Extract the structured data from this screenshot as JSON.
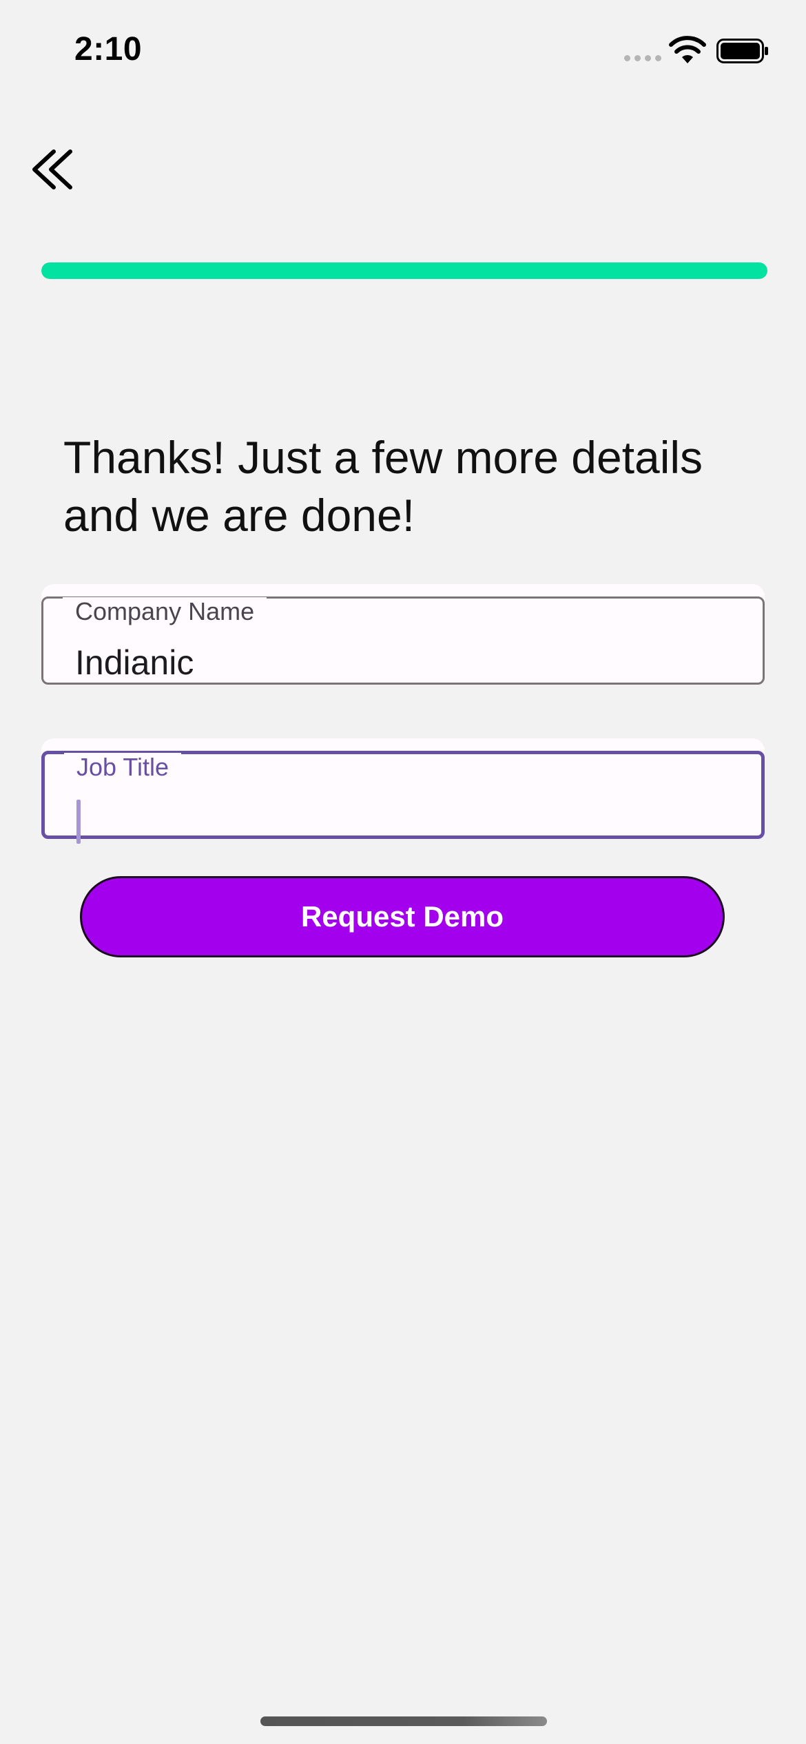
{
  "status_bar": {
    "time": "2:10"
  },
  "navigation": {
    "back_icon": "double-chevron-left-icon"
  },
  "progress": {
    "percent": 100,
    "color": "#03e2a1"
  },
  "heading": {
    "text": "Thanks! Just a few more details and we are done!"
  },
  "form": {
    "company_name": {
      "label": "Company Name",
      "value": "Indianic"
    },
    "job_title": {
      "label": "Job Title",
      "value": "",
      "focused": true,
      "accent": "#6750a4"
    }
  },
  "cta": {
    "label": "Request Demo",
    "color": "#a301ed"
  }
}
